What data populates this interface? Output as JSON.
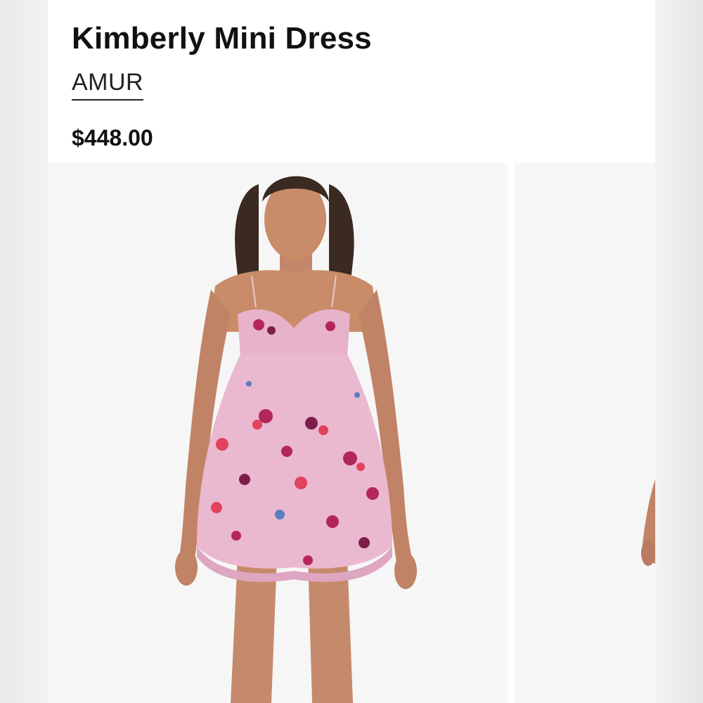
{
  "product": {
    "title": "Kimberly Mini Dress",
    "brand": "AMUR",
    "price": "$448.00"
  },
  "gallery": {
    "images": [
      {
        "name": "model-front-view",
        "subject": "model wearing pink floral babydoll mini dress"
      },
      {
        "name": "model-alternate-view",
        "subject": "partial view of model hand"
      }
    ]
  },
  "colors": {
    "dress_pink": "#eab8cf",
    "flower_magenta": "#b3265a",
    "flower_red": "#e0435b",
    "skin": "#c98c68",
    "hair": "#3a2a22"
  }
}
